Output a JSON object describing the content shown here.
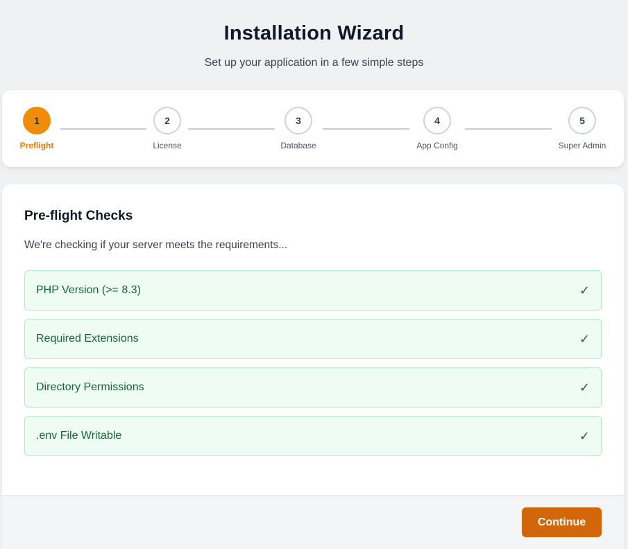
{
  "header": {
    "title": "Installation Wizard",
    "subtitle": "Set up your application in a few simple steps"
  },
  "stepper": {
    "current_step": 1,
    "steps": [
      {
        "number": "1",
        "label": "Preflight"
      },
      {
        "number": "2",
        "label": "License"
      },
      {
        "number": "3",
        "label": "Database"
      },
      {
        "number": "4",
        "label": "App Config"
      },
      {
        "number": "5",
        "label": "Super Admin"
      }
    ]
  },
  "preflight": {
    "title": "Pre-flight Checks",
    "description": "We're checking if your server meets the requirements...",
    "checks": [
      {
        "label": "PHP Version (>= 8.3)",
        "status": "✓"
      },
      {
        "label": "Required Extensions",
        "status": "✓"
      },
      {
        "label": "Directory Permissions",
        "status": "✓"
      },
      {
        "label": ".env File Writable",
        "status": "✓"
      }
    ]
  },
  "footer": {
    "continue_label": "Continue"
  },
  "colors": {
    "accent": "#f08c0a",
    "button": "#d2660a",
    "success_bg": "#effcf3",
    "success_border": "#b4ecc4",
    "success_text": "#166534"
  }
}
